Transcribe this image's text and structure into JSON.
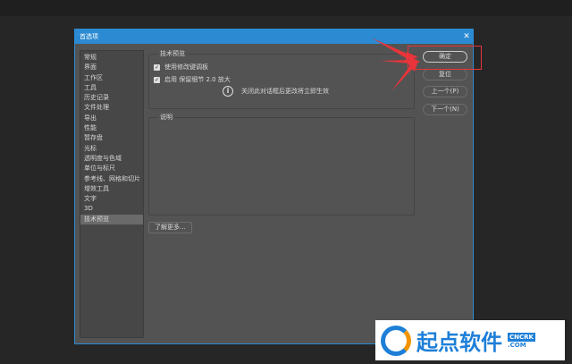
{
  "dialog": {
    "title": "首选项",
    "close": "✕"
  },
  "sidebar": {
    "items": [
      "常规",
      "界面",
      "工作区",
      "工具",
      "历史记录",
      "文件处理",
      "导出",
      "性能",
      "暂存盘",
      "光标",
      "透明度与色域",
      "单位与标尺",
      "参考线、网格和切片",
      "增效工具",
      "文字",
      "3D",
      "技术预览"
    ],
    "selected": "技术预览"
  },
  "tech_preview": {
    "label": "技术预览",
    "options": [
      {
        "label": "使用修改键调板",
        "checked": true
      },
      {
        "label": "启用 保留细节 2.0 放大",
        "checked": true
      }
    ],
    "info": "关闭此对话框后更改将立即生效"
  },
  "description": {
    "label": "说明"
  },
  "learn_more": "了解更多...",
  "buttons": {
    "ok": "确定",
    "reset": "复位",
    "prev": "上一个(P)",
    "next": "下一个(N)"
  },
  "watermark": {
    "name": "起点软件",
    "tag1": "CNCRK",
    "tag2": ".COM"
  },
  "colors": {
    "accent": "#2b8ad2",
    "highlight": "#e8343a"
  }
}
